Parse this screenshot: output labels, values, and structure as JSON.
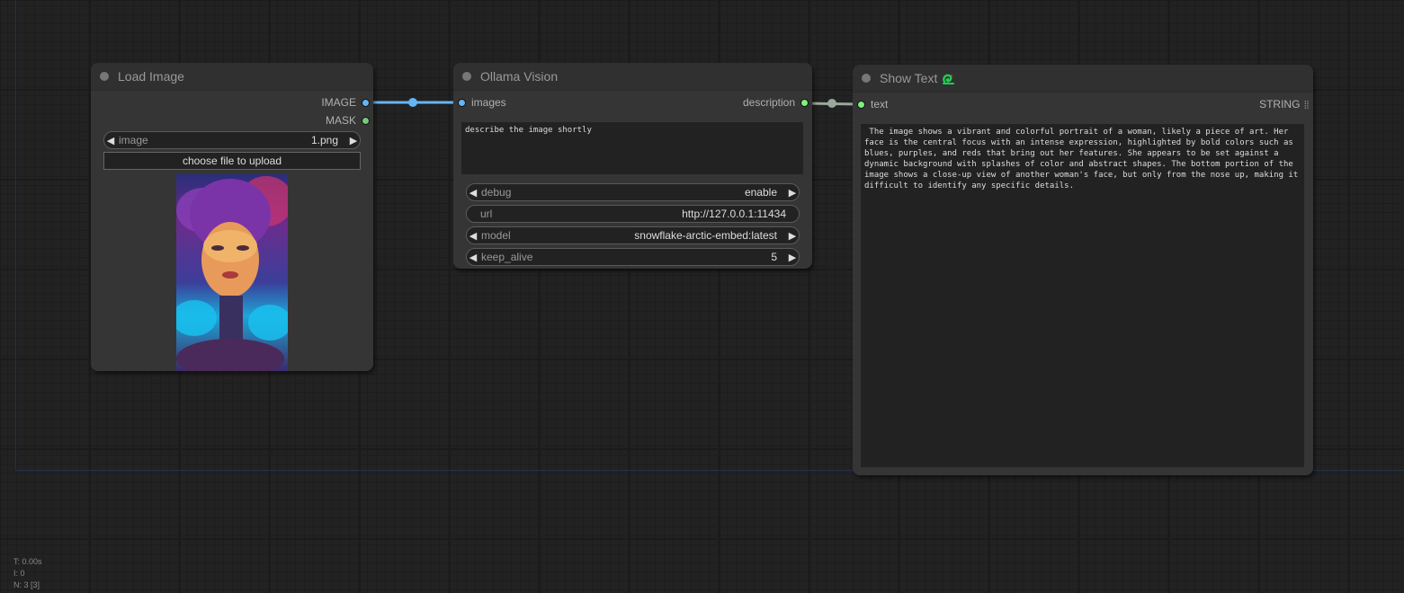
{
  "canvas": {
    "stats": {
      "time": "T: 0.00s",
      "iterations": "I: 0",
      "nodes": "N: 3 [3]"
    }
  },
  "colors": {
    "image_link": "#64b5f6",
    "string_link": "#9aa89a",
    "accent_icon": "#22cc55"
  },
  "nodes": {
    "load_image": {
      "title": "Load Image",
      "outputs": [
        {
          "label": "IMAGE",
          "type": "image"
        },
        {
          "label": "MASK",
          "type": "mask"
        }
      ],
      "widgets": {
        "image": {
          "label": "image",
          "value": "1.png"
        }
      },
      "upload_button": "choose file to upload",
      "preview": "portrait-image"
    },
    "ollama_vision": {
      "title": "Ollama Vision",
      "inputs": [
        {
          "label": "images"
        }
      ],
      "outputs": [
        {
          "label": "description"
        }
      ],
      "prompt": "describe the image shortly",
      "widgets": [
        {
          "label": "debug",
          "value": "enable"
        },
        {
          "label": "url",
          "value": "http://127.0.0.1:11434"
        },
        {
          "label": "model",
          "value": "snowflake-arctic-embed:latest"
        },
        {
          "label": "keep_alive",
          "value": "5"
        }
      ]
    },
    "show_text": {
      "title": "Show Text",
      "title_icon": "snake-icon",
      "inputs": [
        {
          "label": "text"
        }
      ],
      "outputs": [
        {
          "label": "STRING"
        }
      ],
      "text": " The image shows a vibrant and colorful portrait of a woman, likely a piece of art. Her face is the central focus with an intense expression, highlighted by bold colors such as blues, purples, and reds that bring out her features. She appears to be set against a dynamic background with splashes of color and abstract shapes. The bottom portion of the image shows a close-up view of another woman's face, but only from the nose up, making it difficult to identify any specific details."
    }
  }
}
